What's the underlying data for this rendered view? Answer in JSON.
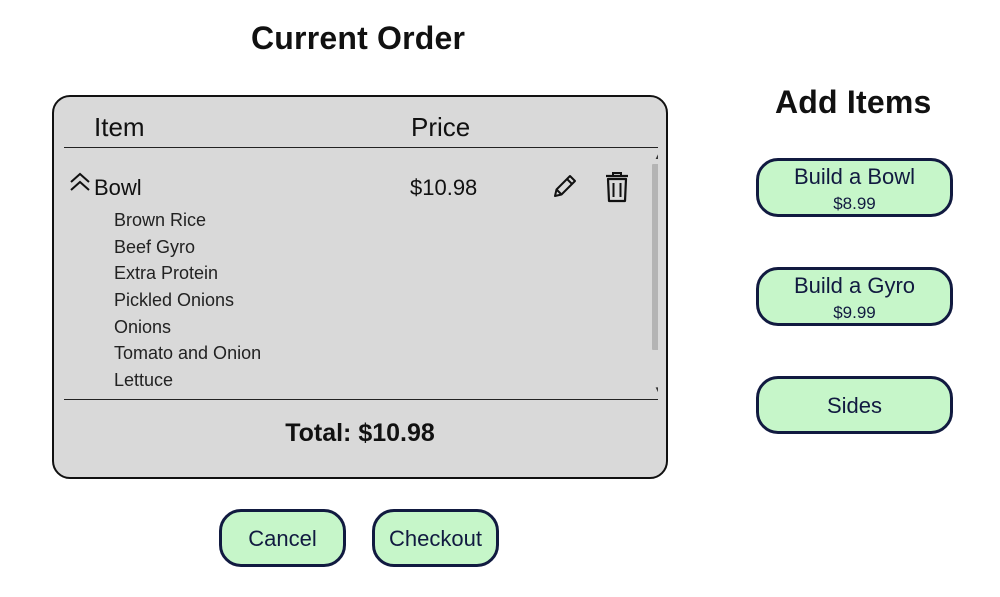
{
  "order": {
    "title": "Current Order",
    "columns": {
      "item": "Item",
      "price": "Price"
    },
    "items": [
      {
        "name": "Bowl",
        "price": "$10.98",
        "expanded": true,
        "ingredients": [
          "Brown Rice",
          "Beef Gyro",
          "Extra Protein",
          "Pickled Onions",
          "Onions",
          "Tomato and Onion",
          "Lettuce"
        ]
      }
    ],
    "total": "Total: $10.98"
  },
  "actions": {
    "cancel_label": "Cancel",
    "checkout_label": "Checkout"
  },
  "add_items": {
    "title": "Add Items",
    "buttons": [
      {
        "label": "Build a Bowl",
        "price": "$8.99"
      },
      {
        "label": "Build a Gyro",
        "price": "$9.99"
      },
      {
        "label": "Sides"
      }
    ]
  },
  "icons": {
    "expand": "chevron-double-up-icon",
    "edit": "pencil-icon",
    "delete": "trash-icon"
  },
  "colors": {
    "button_fill": "#c6f6c9",
    "button_border": "#111a40",
    "panel_background": "#d9d9d9"
  }
}
